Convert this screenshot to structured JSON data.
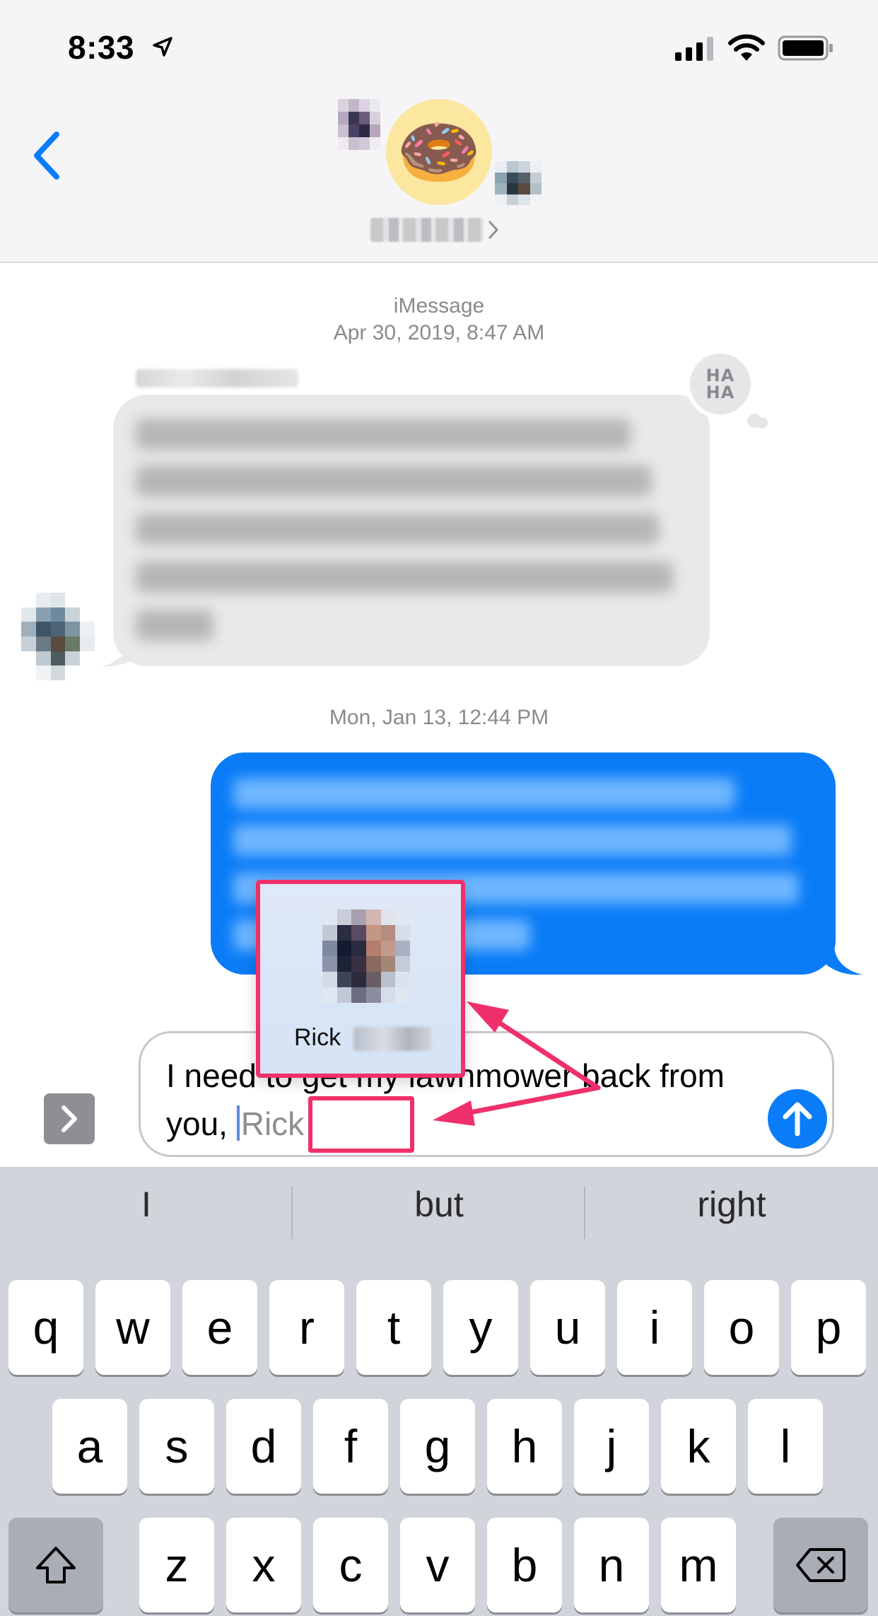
{
  "status_bar": {
    "time": "8:33",
    "location_icon": "location-arrow-icon",
    "signal_icon": "cellular-signal-icon",
    "wifi_icon": "wifi-icon",
    "battery_icon": "battery-icon"
  },
  "header": {
    "back_icon": "chevron-left-icon",
    "group_avatar_icon": "donut-emoji",
    "group_avatar_emoji": "🍩"
  },
  "conversation": {
    "service_label": "iMessage",
    "first_timestamp": "Apr 30, 2019, 8:47 AM",
    "incoming_tapback": "HA HA",
    "second_timestamp": "Mon, Jan 13, 12:44 PM"
  },
  "mention_suggestion": {
    "first_name": "Rick"
  },
  "composer": {
    "text_before_mention": "I need to get my lawnmower back from you, ",
    "mention_token": "Rick",
    "apps_icon": "chevron-right-icon",
    "send_icon": "arrow-up-icon"
  },
  "keyboard": {
    "predictions": [
      "I",
      "but",
      "right"
    ],
    "row1": [
      "q",
      "w",
      "e",
      "r",
      "t",
      "y",
      "u",
      "i",
      "o",
      "p"
    ],
    "row2": [
      "a",
      "s",
      "d",
      "f",
      "g",
      "h",
      "j",
      "k",
      "l"
    ],
    "row3": [
      "z",
      "x",
      "c",
      "v",
      "b",
      "n",
      "m"
    ],
    "shift_icon": "shift-icon",
    "delete_icon": "backspace-icon"
  },
  "colors": {
    "imessage_blue": "#0a7cf7",
    "annotation_pink": "#f0306a",
    "incoming_bubble": "#e9e9eb"
  }
}
